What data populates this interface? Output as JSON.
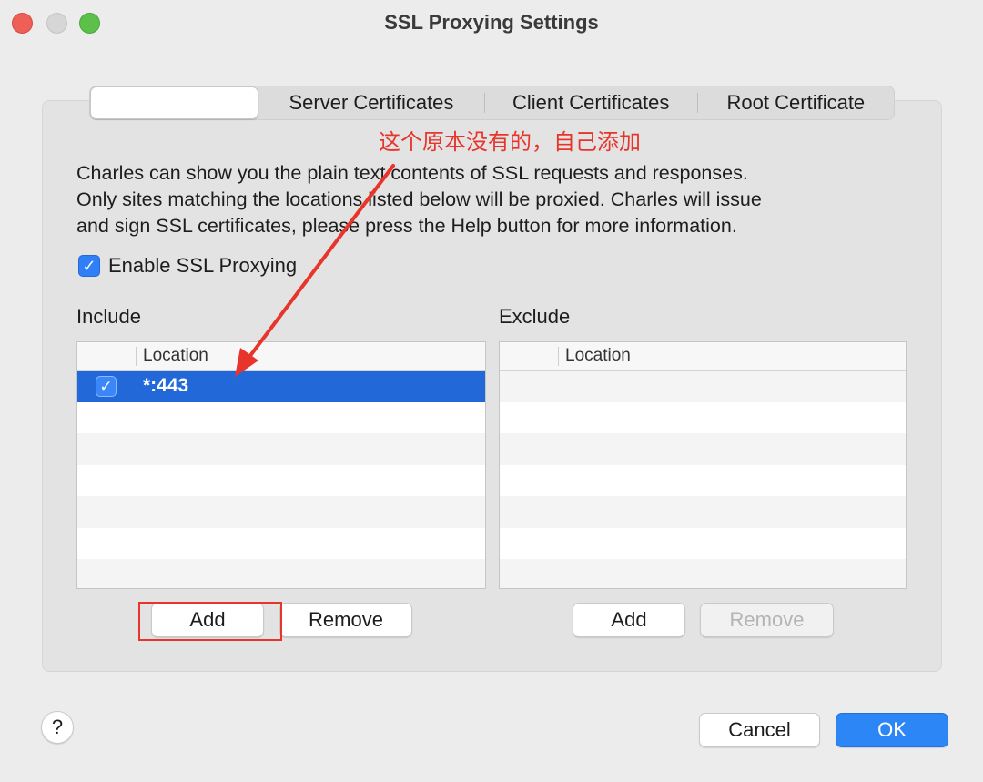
{
  "window": {
    "title": "SSL Proxying Settings"
  },
  "tabs": [
    {
      "label": ""
    },
    {
      "label": "Server Certificates"
    },
    {
      "label": "Client Certificates"
    },
    {
      "label": "Root Certificate"
    }
  ],
  "annotation": {
    "text": "这个原本没有的，自己添加",
    "color": "#e8352b"
  },
  "description": {
    "line1": "Charles can show you the plain text contents of SSL requests and responses.",
    "line2": "Only sites matching the locations listed below will be proxied. Charles will issue",
    "line3": "and sign SSL certificates, please press the Help button for more information."
  },
  "enable_ssl": {
    "label": "Enable SSL Proxying",
    "checked": true
  },
  "include": {
    "label": "Include",
    "column": "Location",
    "rows": [
      {
        "location": "*:443",
        "enabled": true,
        "selected": true
      }
    ],
    "add_label": "Add",
    "remove_label": "Remove"
  },
  "exclude": {
    "label": "Exclude",
    "column": "Location",
    "rows": [],
    "add_label": "Add",
    "remove_label": "Remove"
  },
  "footer": {
    "help_label": "?",
    "cancel_label": "Cancel",
    "ok_label": "OK"
  },
  "icons": {
    "check": "✓"
  },
  "colors": {
    "accent": "#2d86f5",
    "selection": "#2268d9",
    "annotation": "#e8352b"
  }
}
